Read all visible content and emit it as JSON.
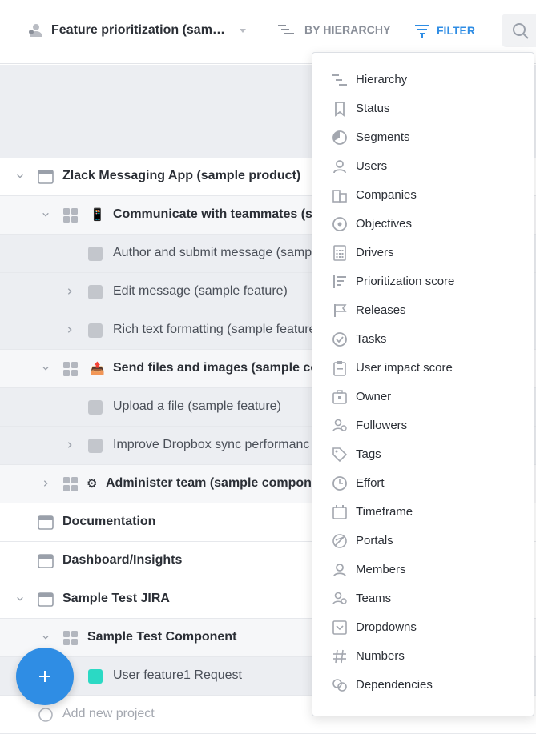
{
  "topbar": {
    "board_title": "Feature prioritization (sam…",
    "hierarchy_label": "BY HIERARCHY",
    "filter_label": "FILTER"
  },
  "tree": [
    {
      "label": "Zlack Messaging App (sample product)",
      "type": "product",
      "style": "bold"
    },
    {
      "label": "Communicate with teammates (sa",
      "type": "component",
      "emoji": "📱",
      "style": "bold"
    },
    {
      "label": "Author and submit message (samp",
      "type": "feature",
      "style": "normal"
    },
    {
      "label": "Edit message (sample feature)",
      "type": "feature",
      "style": "normal"
    },
    {
      "label": "Rich text formatting (sample feature",
      "type": "feature",
      "style": "normal"
    },
    {
      "label": "Send files and images (sample co",
      "type": "component",
      "emoji": "📤",
      "style": "bold"
    },
    {
      "label": "Upload a file (sample feature)",
      "type": "feature",
      "style": "normal"
    },
    {
      "label": "Improve Dropbox sync performanc",
      "type": "feature",
      "style": "normal"
    },
    {
      "label": "Administer team (sample compone",
      "type": "component",
      "emoji": "⚙",
      "style": "bold"
    },
    {
      "label": "Documentation",
      "type": "product",
      "style": "bold"
    },
    {
      "label": "Dashboard/Insights",
      "type": "product",
      "style": "bold"
    },
    {
      "label": "Sample Test JIRA",
      "type": "product",
      "style": "bold"
    },
    {
      "label": "Sample Test Component",
      "type": "component",
      "style": "bold"
    },
    {
      "label": "User feature1 Request",
      "type": "feature",
      "style": "normal",
      "color": "#2bd9c4"
    },
    {
      "label": "Add new project",
      "type": "add",
      "style": "normal"
    }
  ],
  "filter_menu": {
    "items": [
      {
        "label": "Hierarchy",
        "icon": "hierarchy-icon"
      },
      {
        "label": "Status",
        "icon": "bookmark-icon"
      },
      {
        "label": "Segments",
        "icon": "pie-icon"
      },
      {
        "label": "Users",
        "icon": "user-icon"
      },
      {
        "label": "Companies",
        "icon": "building-icon"
      },
      {
        "label": "Objectives",
        "icon": "target-icon"
      },
      {
        "label": "Drivers",
        "icon": "calculator-icon"
      },
      {
        "label": "Prioritization score",
        "icon": "score-icon"
      },
      {
        "label": "Releases",
        "icon": "flag-icon"
      },
      {
        "label": "Tasks",
        "icon": "check-circle-icon"
      },
      {
        "label": "User impact score",
        "icon": "clipboard-icon"
      },
      {
        "label": "Owner",
        "icon": "briefcase-icon"
      },
      {
        "label": "Followers",
        "icon": "followers-icon"
      },
      {
        "label": "Tags",
        "icon": "tag-icon"
      },
      {
        "label": "Effort",
        "icon": "clock-icon"
      },
      {
        "label": "Timeframe",
        "icon": "calendar-icon"
      },
      {
        "label": "Portals",
        "icon": "portal-icon"
      },
      {
        "label": "Members",
        "icon": "member-icon"
      },
      {
        "label": "Teams",
        "icon": "team-icon"
      },
      {
        "label": "Dropdowns",
        "icon": "dropdown-icon"
      },
      {
        "label": "Numbers",
        "icon": "hash-icon"
      },
      {
        "label": "Dependencies",
        "icon": "link-icon"
      }
    ]
  },
  "colors": {
    "accent": "#2f8de4",
    "feature_teal": "#2bd9c4"
  }
}
